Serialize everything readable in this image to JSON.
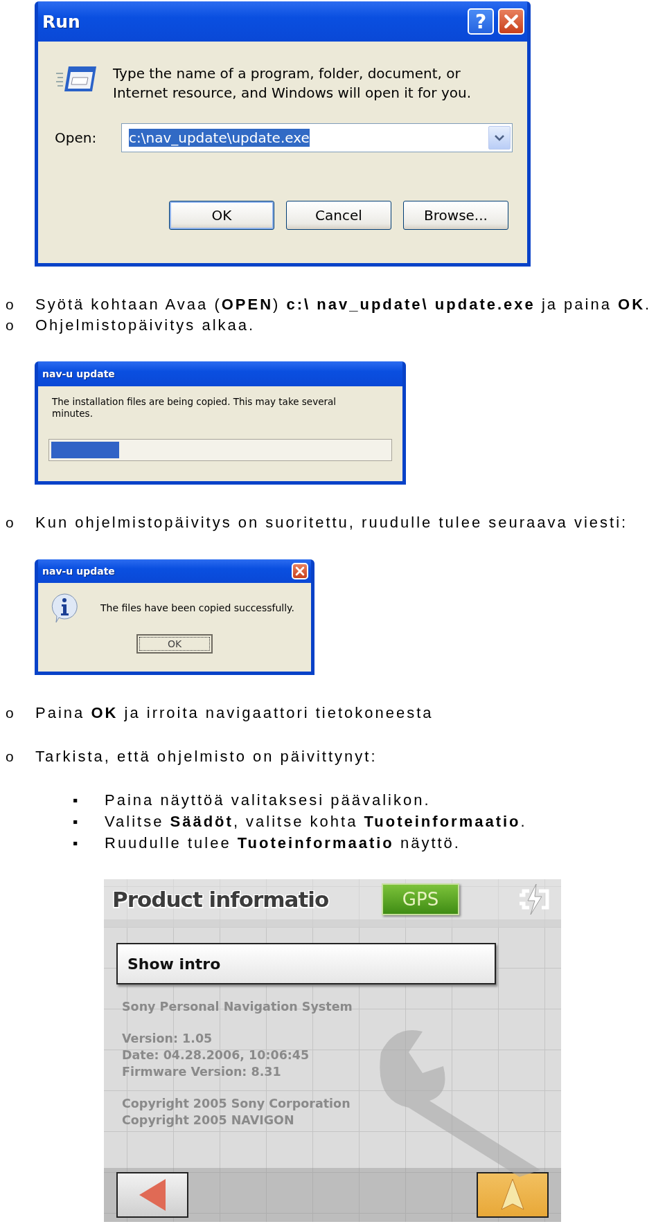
{
  "run_dialog": {
    "title": "Run",
    "help_button": "?",
    "description": "Type the name of a program, folder, document, or Internet resource, and Windows will open it for you.",
    "open_label": "Open:",
    "input_value": "c:\\nav_update\\update.exe",
    "buttons": [
      {
        "label": "OK",
        "default": true
      },
      {
        "label": "Cancel",
        "default": false
      },
      {
        "label": "Browse...",
        "default": false
      }
    ]
  },
  "steps_a": [
    {
      "marker": "o",
      "text": "Syötä kohtaan Avaa (**OPEN**) **c:\\ nav_update\\ update.exe** ja paina **OK**."
    },
    {
      "marker": "o",
      "text": "Ohjelmistopäivitys alkaa."
    }
  ],
  "progress_dialog": {
    "title": "nav-u update",
    "message": "The installation files are being copied. This may take several minutes.",
    "progress": {
      "level": 0.2
    }
  },
  "steps_b": [
    {
      "marker": "o",
      "text": "Kun ohjelmistopäivitys on suoritettu, ruudulle tulee seuraava viesti:"
    }
  ],
  "message_dialog": {
    "title": "nav-u update",
    "message": "The files have been copied successfully.",
    "button": "OK"
  },
  "steps_c": [
    {
      "marker": "o",
      "text": "Paina **OK** ja irroita navigaattori tietokoneesta"
    },
    {
      "marker": "o",
      "text": "Tarkista, että ohjelmisto on päivittynyt:",
      "children": [
        {
          "marker": "▪",
          "text": "Paina näyttöä valitaksesi päävalikon."
        },
        {
          "marker": "▪",
          "text": "Valitse **Säädöt**, valitse kohta **Tuoteinformaatio**."
        },
        {
          "marker": "▪",
          "text": "Ruudulle tulee **Tuoteinformaatio** näyttö."
        }
      ]
    }
  ],
  "device_screen": {
    "title": "Product informatio",
    "gps_label": "GPS",
    "menu_item": "Show intro",
    "info_groups": [
      {
        "lines": [
          "Sony Personal Navigation System"
        ]
      },
      {
        "lines": [
          "Version: 1.05",
          "Date: 04.28.2006, 10:06:45",
          "Firmware Version: 8.31"
        ]
      },
      {
        "lines": [
          "Copyright 2005 Sony Corporation",
          "Copyright 2005 NAVIGON"
        ]
      }
    ]
  }
}
